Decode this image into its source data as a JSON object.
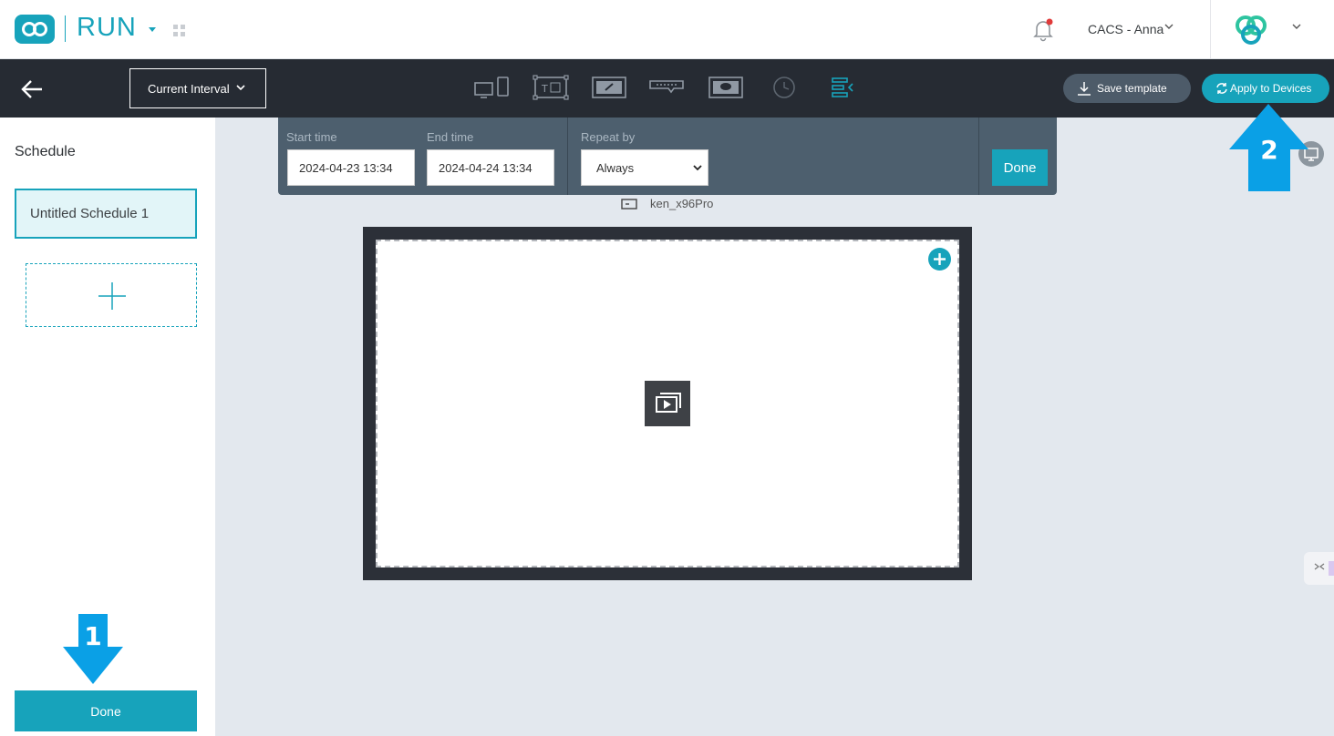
{
  "header": {
    "app_name": "RUN",
    "user_name": "CACS - Anna"
  },
  "toolbar": {
    "interval_label": "Current Interval",
    "save_template_label": "Save template",
    "apply_label": "Apply to Devices",
    "tools": [
      "device-icon",
      "text-widget-icon",
      "image-widget-icon",
      "ticker-icon",
      "message-icon",
      "clock-icon",
      "align-icon"
    ]
  },
  "sidebar": {
    "title": "Schedule",
    "items": [
      {
        "label": "Untitled Schedule 1",
        "selected": true
      }
    ],
    "done_label": "Done"
  },
  "time_panel": {
    "start_label": "Start time",
    "start_value": "2024-04-23 13:34",
    "end_label": "End time",
    "end_value": "2024-04-24 13:34",
    "repeat_label": "Repeat by",
    "repeat_value": "Always",
    "done_label": "Done"
  },
  "canvas": {
    "device_name": "ken_x96Pro"
  },
  "annotations": {
    "step1": "1",
    "step2": "2"
  },
  "colors": {
    "accent": "#17a3bb",
    "toolbar_bg": "#262b33",
    "panel_bg": "#4d5f6e",
    "annotation_blue": "#0aa0e6"
  }
}
